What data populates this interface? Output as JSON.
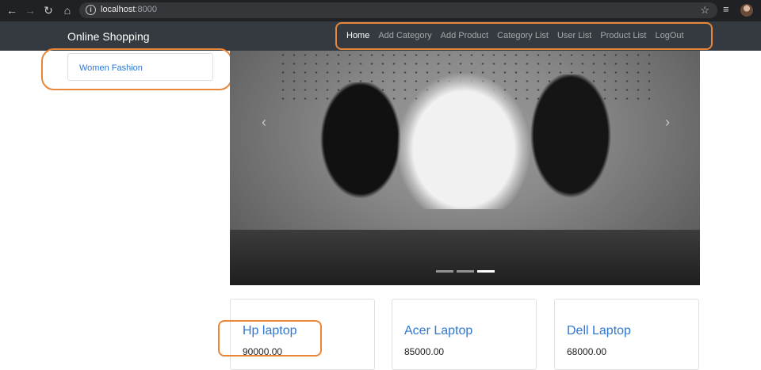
{
  "browser": {
    "url_host": "localhost",
    "url_port": ":8000",
    "icons": {
      "back": "back-arrow-icon",
      "forward": "forward-arrow-icon",
      "reload": "reload-icon",
      "home": "home-icon",
      "info": "info-icon",
      "star": "bookmark-star-icon",
      "media": "media-queue-icon",
      "profile": "profile-avatar"
    }
  },
  "navbar": {
    "brand": "Online Shopping",
    "links": [
      "Home",
      "Add Category",
      "Add Product",
      "Category List",
      "User List",
      "Product List",
      "LogOut"
    ],
    "active": "Home"
  },
  "sidebar": {
    "categories": [
      "Women Fashion"
    ]
  },
  "carousel": {
    "prev_icon": "chevron-left-icon",
    "next_icon": "chevron-right-icon",
    "slides_count": 3,
    "active_slide": 3
  },
  "products": [
    {
      "name": "Hp laptop",
      "price": "90000.00"
    },
    {
      "name": "Acer Laptop",
      "price": "85000.00"
    },
    {
      "name": "Dell Laptop",
      "price": "68000.00"
    }
  ],
  "colors": {
    "highlight": "#e8863a",
    "navbar_bg": "#343a40",
    "link_blue": "#2f77d1"
  }
}
